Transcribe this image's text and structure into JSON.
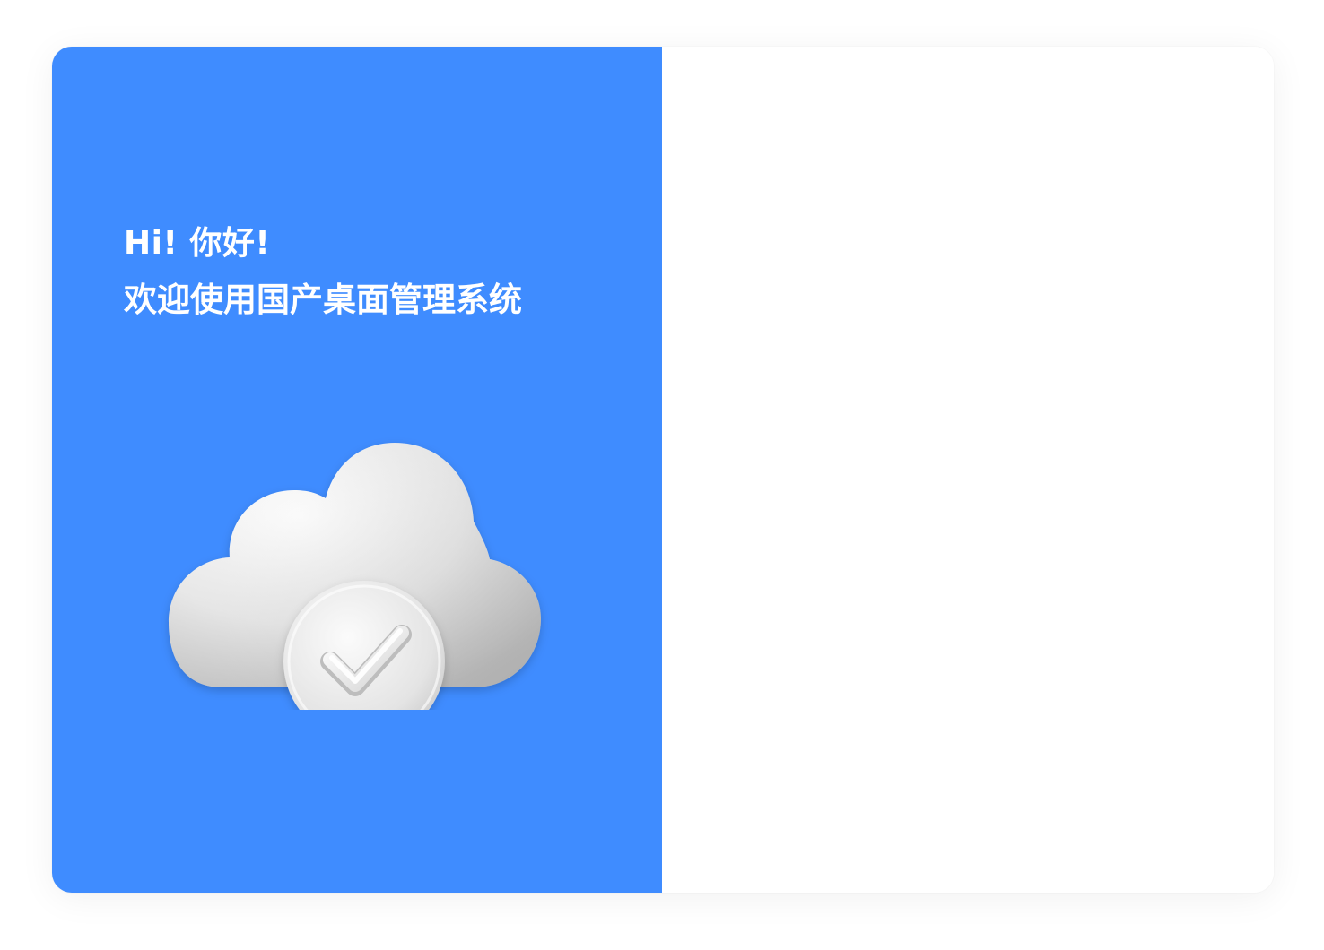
{
  "welcome_panel": {
    "greeting": "Hi!  你好!",
    "welcome_text": "欢迎使用国产桌面管理系统",
    "accent_color": "#3f8cff",
    "illustration_icon": "cloud-check-icon"
  }
}
